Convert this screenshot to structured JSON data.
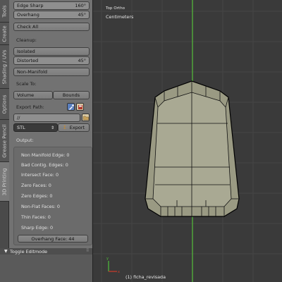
{
  "tabs": [
    "Tools",
    "Create",
    "Shading / UVs",
    "Options",
    "Grease Pencil",
    "3D Printing"
  ],
  "checks": {
    "edge_sharp": {
      "label": "Edge Sharp",
      "value": "160°"
    },
    "overhang": {
      "label": "Overhang",
      "value": "45°"
    },
    "check_all": "Check All"
  },
  "cleanup": {
    "heading": "Cleanup:",
    "isolated": "Isolated",
    "distorted": {
      "label": "Distorted",
      "value": "45°"
    },
    "non_manifold": "Non-Manifold"
  },
  "scale": {
    "heading": "Scale To:",
    "volume": "Volume",
    "bounds": "Bounds"
  },
  "export": {
    "heading": "Export Path:",
    "path": "//",
    "format": "STL",
    "button": "Export"
  },
  "output": {
    "heading": "Output:",
    "lines": [
      "Non Manifold Edge: 0",
      "Bad Contig. Edges: 0",
      "Intersect Face: 0",
      "Zero Faces: 0",
      "Zero Edges: 0",
      "Non-Flat Faces: 0",
      "Thin Faces: 0",
      "Sharp Edge: 0"
    ],
    "overhang_face": "Overhang Face: 44"
  },
  "toggle": "Toggle Editmode",
  "viewport": {
    "view": "Top Ortho",
    "units": "Centimeters",
    "object": "(1) ficha_revisada"
  }
}
